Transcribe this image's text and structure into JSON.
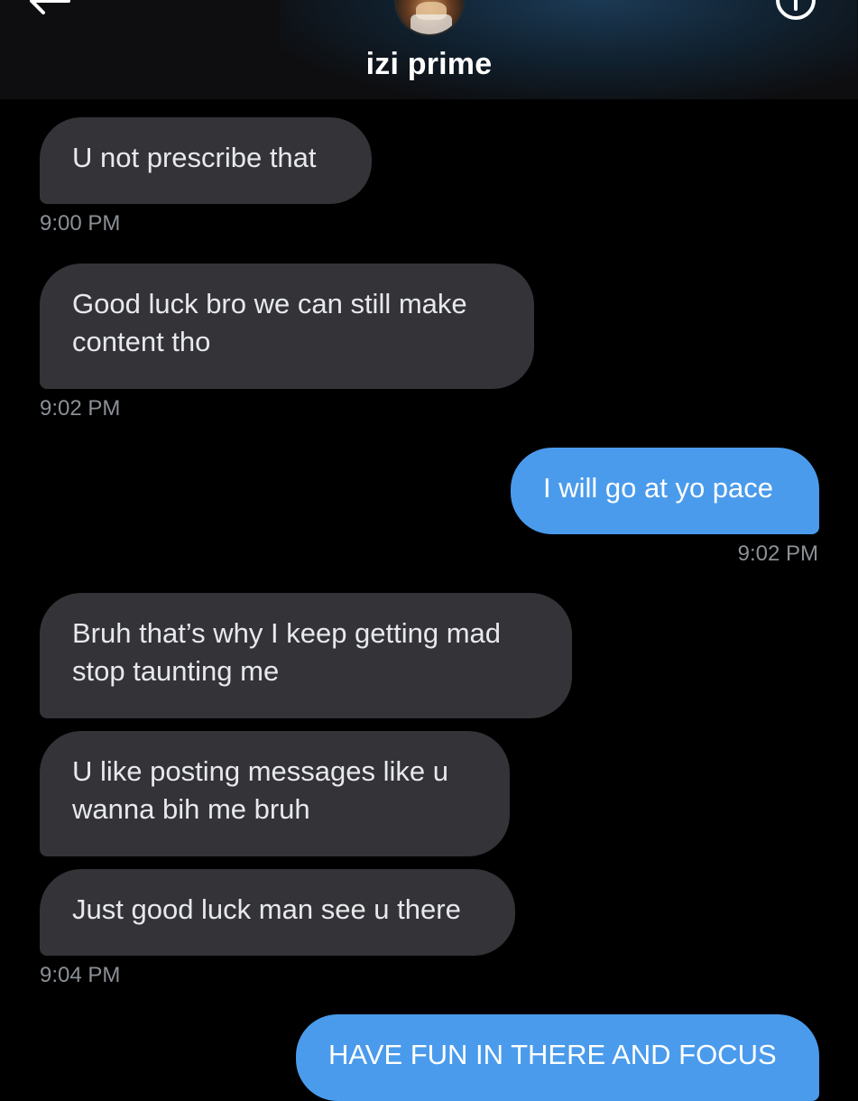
{
  "header": {
    "contact_name": "izi prime",
    "back_icon": "arrow-left-icon",
    "info_icon": "info-icon",
    "glow_color": "#1c3a55"
  },
  "colors": {
    "background": "#000000",
    "incoming_bubble": "#333338",
    "outgoing_bubble": "#4a9bec",
    "timestamp": "#8b9096"
  },
  "messages": [
    {
      "direction": "incoming",
      "text": "U not prescribe that",
      "time": "9:00 PM"
    },
    {
      "direction": "incoming",
      "text": "Good luck bro we can still make\ncontent tho",
      "time": "9:02 PM"
    },
    {
      "direction": "outgoing",
      "text": "I will go at yo pace",
      "time": "9:02 PM"
    },
    {
      "direction": "incoming",
      "text": "Bruh that’s why I keep getting mad\nstop taunting me",
      "time": ""
    },
    {
      "direction": "incoming",
      "text": "U like posting messages like u\nwanna bih me bruh",
      "time": ""
    },
    {
      "direction": "incoming",
      "text": "Just good luck man see u there",
      "time": "9:04 PM"
    },
    {
      "direction": "outgoing",
      "text": "HAVE FUN IN THERE AND FOCUS",
      "time": ""
    }
  ]
}
